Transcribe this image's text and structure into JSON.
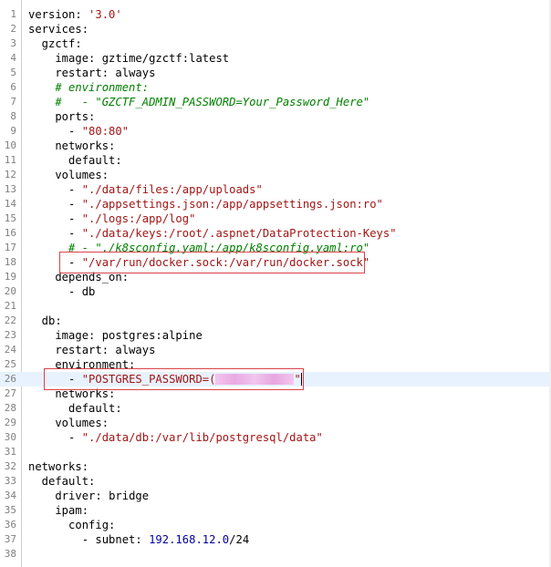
{
  "editor": {
    "current_line": 26,
    "lines": [
      {
        "n": "1",
        "segs": [
          [
            "key",
            "version: "
          ],
          [
            "str",
            "'3.0'"
          ]
        ]
      },
      {
        "n": "2",
        "segs": [
          [
            "key",
            "services:"
          ]
        ]
      },
      {
        "n": "3",
        "segs": [
          [
            "key",
            "  gzctf:"
          ]
        ]
      },
      {
        "n": "4",
        "segs": [
          [
            "key",
            "    image: "
          ],
          [
            "kw",
            "gztime/gzctf:latest"
          ]
        ]
      },
      {
        "n": "5",
        "segs": [
          [
            "key",
            "    restart: "
          ],
          [
            "kw",
            "always"
          ]
        ]
      },
      {
        "n": "6",
        "segs": [
          [
            "cmt",
            "    # environment:"
          ]
        ]
      },
      {
        "n": "7",
        "segs": [
          [
            "cmt",
            "    #   - \"GZCTF_ADMIN_PASSWORD=Your_Password_Here\""
          ]
        ]
      },
      {
        "n": "8",
        "segs": [
          [
            "key",
            "    ports:"
          ]
        ]
      },
      {
        "n": "9",
        "segs": [
          [
            "key",
            "      - "
          ],
          [
            "str",
            "\"80:80\""
          ]
        ]
      },
      {
        "n": "10",
        "segs": [
          [
            "key",
            "    networks:"
          ]
        ]
      },
      {
        "n": "11",
        "segs": [
          [
            "key",
            "      default:"
          ]
        ]
      },
      {
        "n": "12",
        "segs": [
          [
            "key",
            "    volumes:"
          ]
        ]
      },
      {
        "n": "13",
        "segs": [
          [
            "key",
            "      - "
          ],
          [
            "str",
            "\"./data/files:/app/uploads\""
          ]
        ]
      },
      {
        "n": "14",
        "segs": [
          [
            "key",
            "      - "
          ],
          [
            "str",
            "\"./appsettings.json:/app/appsettings.json:ro\""
          ]
        ]
      },
      {
        "n": "15",
        "segs": [
          [
            "key",
            "      - "
          ],
          [
            "str",
            "\"./logs:/app/log\""
          ]
        ]
      },
      {
        "n": "16",
        "segs": [
          [
            "key",
            "      - "
          ],
          [
            "str",
            "\"./data/keys:/root/.aspnet/DataProtection-Keys\""
          ]
        ]
      },
      {
        "n": "17",
        "segs": [
          [
            "cmt",
            "      # - \"./k8sconfig.yaml:/app/k8sconfig.yaml:ro\""
          ]
        ]
      },
      {
        "n": "18",
        "segs": [
          [
            "key",
            "      - "
          ],
          [
            "str",
            "\"/var/run/docker.sock:/var/run/docker.sock\""
          ]
        ]
      },
      {
        "n": "19",
        "segs": [
          [
            "key",
            "    depends_on:"
          ]
        ]
      },
      {
        "n": "20",
        "segs": [
          [
            "key",
            "      - "
          ],
          [
            "kw",
            "db"
          ]
        ]
      },
      {
        "n": "21",
        "segs": []
      },
      {
        "n": "22",
        "segs": [
          [
            "key",
            "  db:"
          ]
        ]
      },
      {
        "n": "23",
        "segs": [
          [
            "key",
            "    image: "
          ],
          [
            "kw",
            "postgres:alpine"
          ]
        ]
      },
      {
        "n": "24",
        "segs": [
          [
            "key",
            "    restart: "
          ],
          [
            "kw",
            "always"
          ]
        ]
      },
      {
        "n": "25",
        "segs": [
          [
            "key",
            "    environment:"
          ]
        ]
      },
      {
        "n": "26",
        "segs": [
          [
            "key",
            "      - "
          ],
          [
            "str",
            "\"POSTGRES_PASSWORD=("
          ],
          [
            "redact",
            ""
          ],
          [
            "str",
            "\""
          ],
          [
            "caret",
            ""
          ]
        ]
      },
      {
        "n": "27",
        "segs": [
          [
            "key",
            "    networks:"
          ]
        ]
      },
      {
        "n": "28",
        "segs": [
          [
            "key",
            "      default:"
          ]
        ]
      },
      {
        "n": "29",
        "segs": [
          [
            "key",
            "    volumes:"
          ]
        ]
      },
      {
        "n": "30",
        "segs": [
          [
            "key",
            "      - "
          ],
          [
            "str",
            "\"./data/db:/var/lib/postgresql/data\""
          ]
        ]
      },
      {
        "n": "31",
        "segs": []
      },
      {
        "n": "32",
        "segs": [
          [
            "key",
            "networks:"
          ]
        ]
      },
      {
        "n": "33",
        "segs": [
          [
            "key",
            "  default:"
          ]
        ]
      },
      {
        "n": "34",
        "segs": [
          [
            "key",
            "    driver: "
          ],
          [
            "kw",
            "bridge"
          ]
        ]
      },
      {
        "n": "35",
        "segs": [
          [
            "key",
            "    ipam:"
          ]
        ]
      },
      {
        "n": "36",
        "segs": [
          [
            "key",
            "      config:"
          ]
        ]
      },
      {
        "n": "37",
        "segs": [
          [
            "key",
            "        - subnet: "
          ],
          [
            "num",
            "192.168.12.0"
          ],
          [
            "key",
            "/24"
          ]
        ]
      },
      {
        "n": "38",
        "segs": []
      }
    ]
  },
  "colors": {
    "string": "#a31515",
    "comment": "#008000",
    "number": "#0000a0",
    "current_line_bg": "#e8f2fe",
    "annotation_box": "#d9434a"
  }
}
